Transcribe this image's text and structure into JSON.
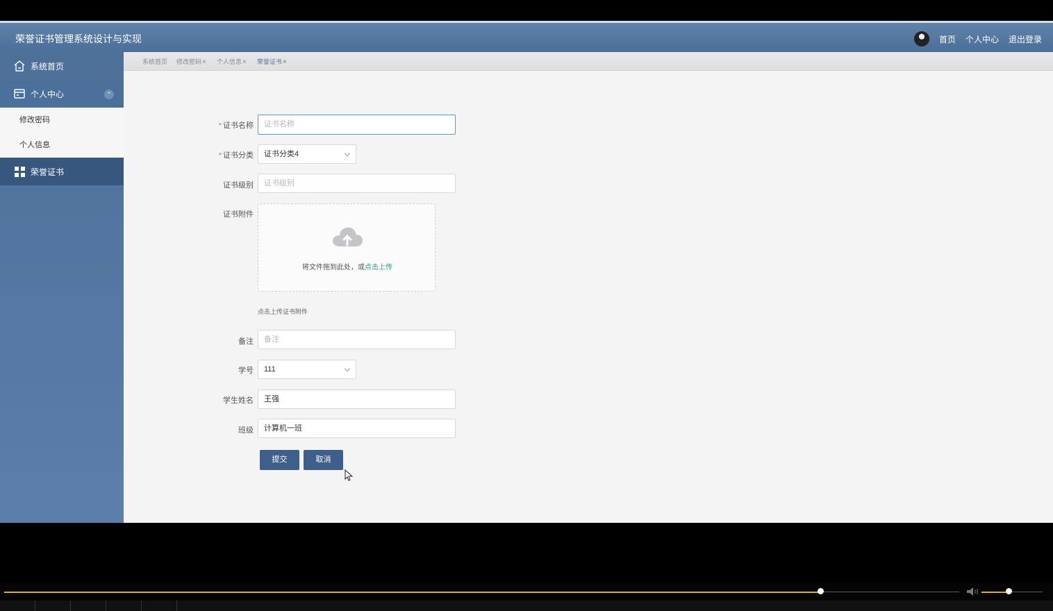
{
  "header": {
    "title": "荣誉证书管理系统设计与实现",
    "links": [
      "首页",
      "个人中心",
      "退出登录"
    ]
  },
  "sidebar": {
    "items": [
      {
        "label": "系统首页",
        "icon": "home-icon"
      },
      {
        "label": "个人中心",
        "icon": "card-icon",
        "expanded": true
      },
      {
        "label": "修改密码"
      },
      {
        "label": "个人信息"
      },
      {
        "label": "荣誉证书",
        "icon": "grid-icon",
        "active": true
      }
    ]
  },
  "tabs": [
    {
      "label": "系统首页",
      "closable": false
    },
    {
      "label": "修改密码",
      "closable": true
    },
    {
      "label": "个人信息",
      "closable": true
    },
    {
      "label": "荣誉证书",
      "closable": true,
      "active": true
    }
  ],
  "form": {
    "certificate_name": {
      "label": "证书名称",
      "placeholder": "证书名称",
      "required": true
    },
    "certificate_category": {
      "label": "证书分类",
      "value": "证书分类4",
      "required": true
    },
    "certificate_level": {
      "label": "证书级别",
      "placeholder": "证书级别"
    },
    "attachment": {
      "label": "证书附件",
      "drop_text": "将文件拖到此处，或",
      "upload_link": "点击上传",
      "tip": "点击上传证书附件"
    },
    "remarks": {
      "label": "备注",
      "placeholder": "备注"
    },
    "student_id": {
      "label": "学号",
      "value": "111"
    },
    "student_name": {
      "label": "学生姓名",
      "value": "王强"
    },
    "class_name": {
      "label": "班级",
      "value": "计算机一班"
    },
    "submit_label": "提交",
    "cancel_label": "取消"
  },
  "player": {
    "progress": 0.855,
    "volume": 0.45,
    "accent": "#d7b32a"
  }
}
